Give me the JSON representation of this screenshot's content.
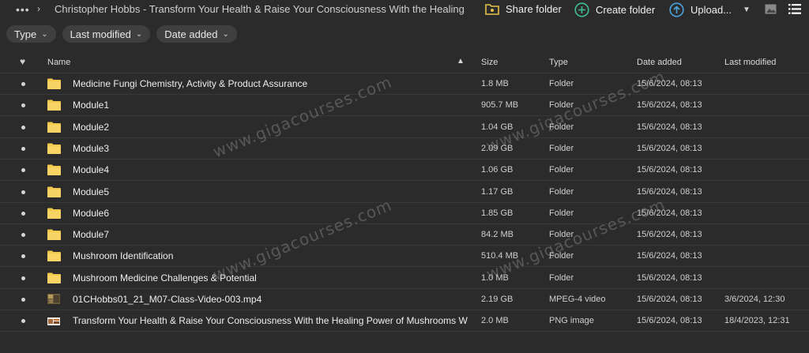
{
  "breadcrumb": {
    "more": "•••",
    "separator": "›",
    "current": "Christopher Hobbs - Transform Your Health & Raise Your Consciousness With the Healing Powe..."
  },
  "toolbar": {
    "share_folder": "Share folder",
    "create_folder": "Create folder",
    "upload": "Upload...",
    "upload_icon": "upload-icon"
  },
  "filters": [
    {
      "label": "Type"
    },
    {
      "label": "Last modified"
    },
    {
      "label": "Date added"
    }
  ],
  "columns": {
    "favorite": "♥",
    "name": "Name",
    "size": "Size",
    "type": "Type",
    "date_added": "Date added",
    "last_modified": "Last modified"
  },
  "rows": [
    {
      "name": "Medicine Fungi Chemistry, Activity & Product Assurance",
      "size": "1.8 MB",
      "type": "Folder",
      "added": "15/6/2024, 08:13",
      "modified": "",
      "icon": "folder"
    },
    {
      "name": "Module1",
      "size": "905.7 MB",
      "type": "Folder",
      "added": "15/6/2024, 08:13",
      "modified": "",
      "icon": "folder"
    },
    {
      "name": "Module2",
      "size": "1.04 GB",
      "type": "Folder",
      "added": "15/6/2024, 08:13",
      "modified": "",
      "icon": "folder"
    },
    {
      "name": "Module3",
      "size": "2.09 GB",
      "type": "Folder",
      "added": "15/6/2024, 08:13",
      "modified": "",
      "icon": "folder"
    },
    {
      "name": "Module4",
      "size": "1.06 GB",
      "type": "Folder",
      "added": "15/6/2024, 08:13",
      "modified": "",
      "icon": "folder"
    },
    {
      "name": "Module5",
      "size": "1.17 GB",
      "type": "Folder",
      "added": "15/6/2024, 08:13",
      "modified": "",
      "icon": "folder"
    },
    {
      "name": "Module6",
      "size": "1.85 GB",
      "type": "Folder",
      "added": "15/6/2024, 08:13",
      "modified": "",
      "icon": "folder"
    },
    {
      "name": "Module7",
      "size": "84.2 MB",
      "type": "Folder",
      "added": "15/6/2024, 08:13",
      "modified": "",
      "icon": "folder"
    },
    {
      "name": "Mushroom Identification",
      "size": "510.4 MB",
      "type": "Folder",
      "added": "15/6/2024, 08:13",
      "modified": "",
      "icon": "folder"
    },
    {
      "name": "Mushroom Medicine Challenges & Potential",
      "size": "1.0 MB",
      "type": "Folder",
      "added": "15/6/2024, 08:13",
      "modified": "",
      "icon": "folder"
    },
    {
      "name": "01CHobbs01_21_M07-Class-Video-003.mp4",
      "size": "2.19 GB",
      "type": "MPEG-4 video",
      "added": "15/6/2024, 08:13",
      "modified": "3/6/2024, 12:30",
      "icon": "video-thumbnail"
    },
    {
      "name": "Transform Your Health & Raise Your Consciousness With the Healing Power of Mushrooms Wi...",
      "size": "2.0 MB",
      "type": "PNG image",
      "added": "15/6/2024, 08:13",
      "modified": "18/4/2023, 12:31",
      "icon": "image-thumbnail"
    }
  ],
  "watermark": "www.gigacourses.com"
}
